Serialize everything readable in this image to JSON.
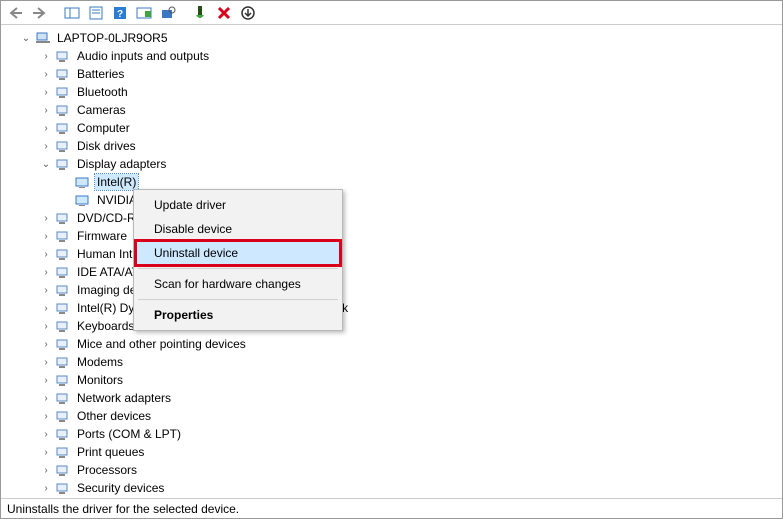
{
  "toolbar": {
    "back": "back-arrow",
    "forward": "forward-arrow",
    "show_hidden": "show-hidden",
    "properties": "properties",
    "help": "help",
    "update": "update-driver",
    "scan": "scan-hardware",
    "enable": "enable-device",
    "uninstall_x": "uninstall",
    "down": "legacy-add"
  },
  "root": {
    "name": "LAPTOP-0LJR9OR5"
  },
  "categories": [
    {
      "label": "Audio inputs and outputs",
      "expanded": false
    },
    {
      "label": "Batteries",
      "expanded": false
    },
    {
      "label": "Bluetooth",
      "expanded": false
    },
    {
      "label": "Cameras",
      "expanded": false
    },
    {
      "label": "Computer",
      "expanded": false
    },
    {
      "label": "Disk drives",
      "expanded": false
    },
    {
      "label": "Display adapters",
      "expanded": true,
      "children": [
        {
          "label": "Intel(R)"
        },
        {
          "label": "NVIDIA"
        }
      ]
    },
    {
      "label": "DVD/CD-R",
      "expanded": false,
      "behind": true
    },
    {
      "label": "Firmware",
      "expanded": false,
      "behind": true
    },
    {
      "label": "Human Int",
      "expanded": false,
      "behind": true
    },
    {
      "label": "IDE ATA/AT",
      "expanded": false,
      "behind": true
    },
    {
      "label": "Imaging de",
      "expanded": false,
      "behind": true
    },
    {
      "label": "Intel(R) Dynamic Platform and Thermal Framework",
      "expanded": false
    },
    {
      "label": "Keyboards",
      "expanded": false
    },
    {
      "label": "Mice and other pointing devices",
      "expanded": false
    },
    {
      "label": "Modems",
      "expanded": false
    },
    {
      "label": "Monitors",
      "expanded": false
    },
    {
      "label": "Network adapters",
      "expanded": false
    },
    {
      "label": "Other devices",
      "expanded": false
    },
    {
      "label": "Ports (COM & LPT)",
      "expanded": false
    },
    {
      "label": "Print queues",
      "expanded": false
    },
    {
      "label": "Processors",
      "expanded": false
    },
    {
      "label": "Security devices",
      "expanded": false
    }
  ],
  "selected_device": "Intel(R)",
  "context_menu": {
    "update": "Update driver",
    "disable": "Disable device",
    "uninstall": "Uninstall device",
    "scan": "Scan for hardware changes",
    "properties": "Properties"
  },
  "status": "Uninstalls the driver for the selected device."
}
